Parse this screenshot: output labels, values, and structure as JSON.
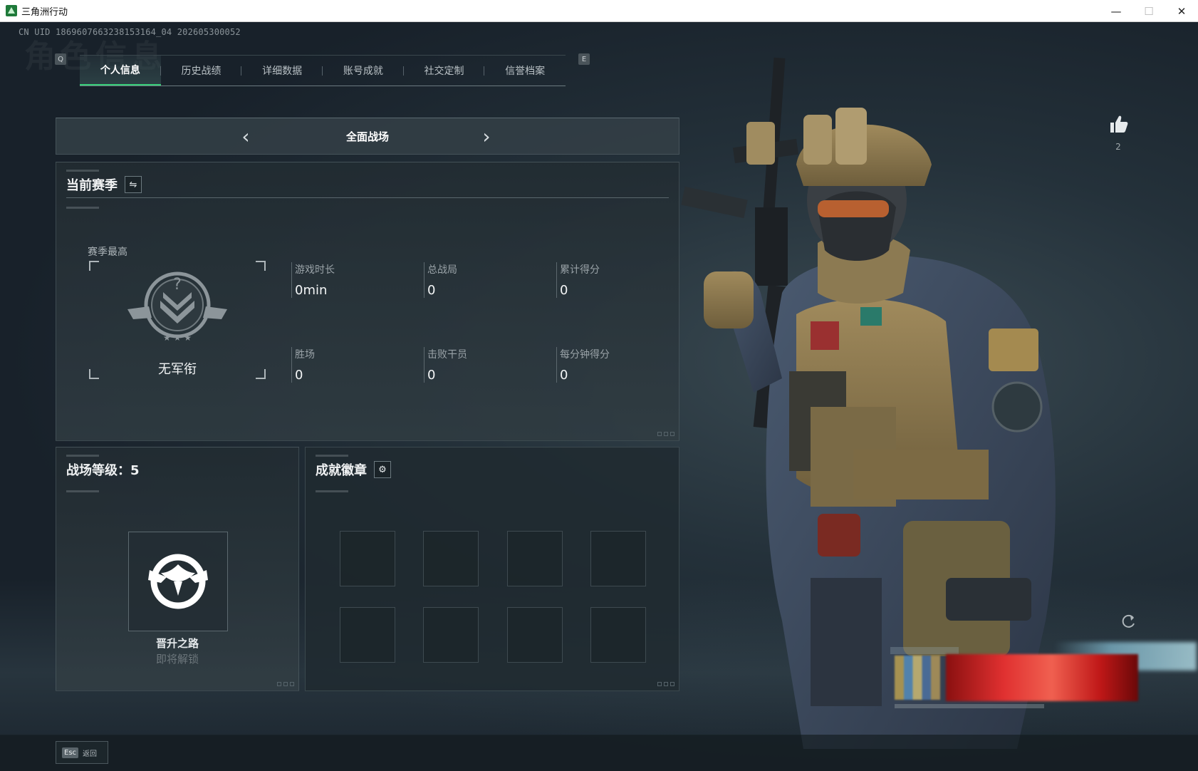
{
  "window": {
    "title": "三角洲行动",
    "controls": {
      "minimize": "—",
      "maximize": "☐",
      "close": "✕"
    }
  },
  "uid": "CN UID 1869607663238153164_04 202605300052",
  "background_title": "角色信息",
  "tabs": {
    "left_key": "Q",
    "right_key": "E",
    "items": [
      {
        "label": "个人信息",
        "active": true
      },
      {
        "label": "历史战绩",
        "active": false
      },
      {
        "label": "详细数据",
        "active": false
      },
      {
        "label": "账号成就",
        "active": false
      },
      {
        "label": "社交定制",
        "active": false
      },
      {
        "label": "信誉档案",
        "active": false
      }
    ]
  },
  "mode_selector": {
    "title": "全面战场",
    "prev_icon": "chevron-left-icon",
    "next_icon": "chevron-right-icon"
  },
  "season": {
    "heading": "当前赛季",
    "swap_icon": "swap-icon",
    "rank_label": "赛季最高",
    "rank_name": "无军衔",
    "stats": [
      {
        "label": "游戏时长",
        "value": "0min"
      },
      {
        "label": "总战局",
        "value": "0"
      },
      {
        "label": "累计得分",
        "value": "0"
      },
      {
        "label": "胜场",
        "value": "0"
      },
      {
        "label": "击败干员",
        "value": "0"
      },
      {
        "label": "每分钟得分",
        "value": "0"
      }
    ]
  },
  "level": {
    "heading": "战场等级：5",
    "card_title": "晋升之路",
    "card_subtitle": "即将解锁",
    "emblem_icon": "eagle-emblem-icon"
  },
  "badges": {
    "heading": "成就徽章",
    "settings_icon": "gear-icon",
    "slots": 8
  },
  "like": {
    "count": "2",
    "icon": "thumbs-up-icon"
  },
  "footer": {
    "key": "Esc",
    "label": "返回"
  },
  "colors": {
    "accent_green": "#39d07a",
    "panel_bg": "#26303a",
    "text_primary": "#f0f2f3",
    "text_muted": "#9aa3a8"
  }
}
